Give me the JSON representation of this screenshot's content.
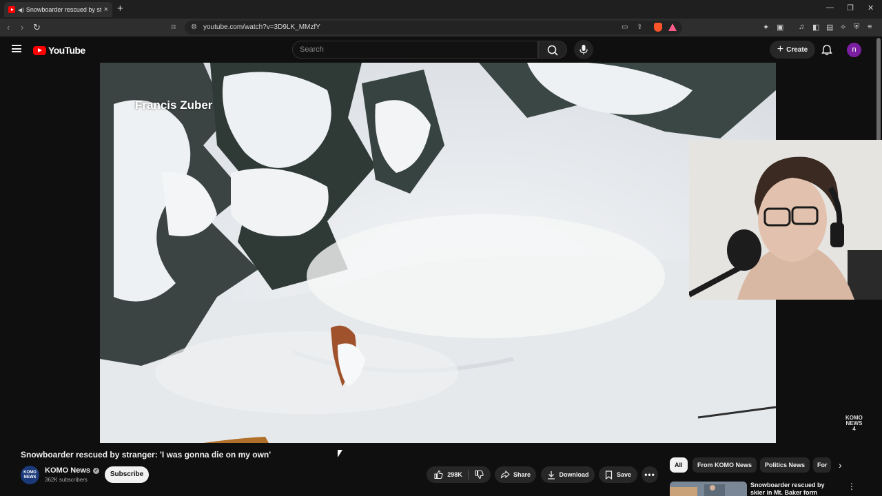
{
  "browser": {
    "tab_title": "Snowboarder rescued by stra",
    "new_tab": "+",
    "close_tab": "×",
    "url": "youtube.com/watch?v=3D9LK_MMzfY"
  },
  "youtube": {
    "logo_text": "YouTube",
    "search_placeholder": "Search",
    "create_label": "Create",
    "avatar_letter": "n"
  },
  "video": {
    "overlay_name": "Francis Zuber",
    "watermark_line1": "KOMO",
    "watermark_line2": "NEWS",
    "watermark_line3": "4",
    "title": "Snowboarder rescued by stranger: 'I was gonna die on my own'"
  },
  "channel": {
    "name": "KOMO News",
    "logo_text_1": "KOMO",
    "logo_text_2": "NEWS",
    "subscribers": "362K subscribers",
    "subscribe_label": "Subscribe"
  },
  "actions": {
    "likes": "298K",
    "share": "Share",
    "download": "Download",
    "save": "Save"
  },
  "chips": [
    "All",
    "From KOMO News",
    "Politics News",
    "For"
  ],
  "recommendation": {
    "title": "Snowboarder rescued by skier in Mt. Baker form lifelong bon"
  },
  "colors": {
    "brand_red": "#ff0000",
    "background": "#0f0f0f",
    "avatar": "#7b1fa2"
  }
}
